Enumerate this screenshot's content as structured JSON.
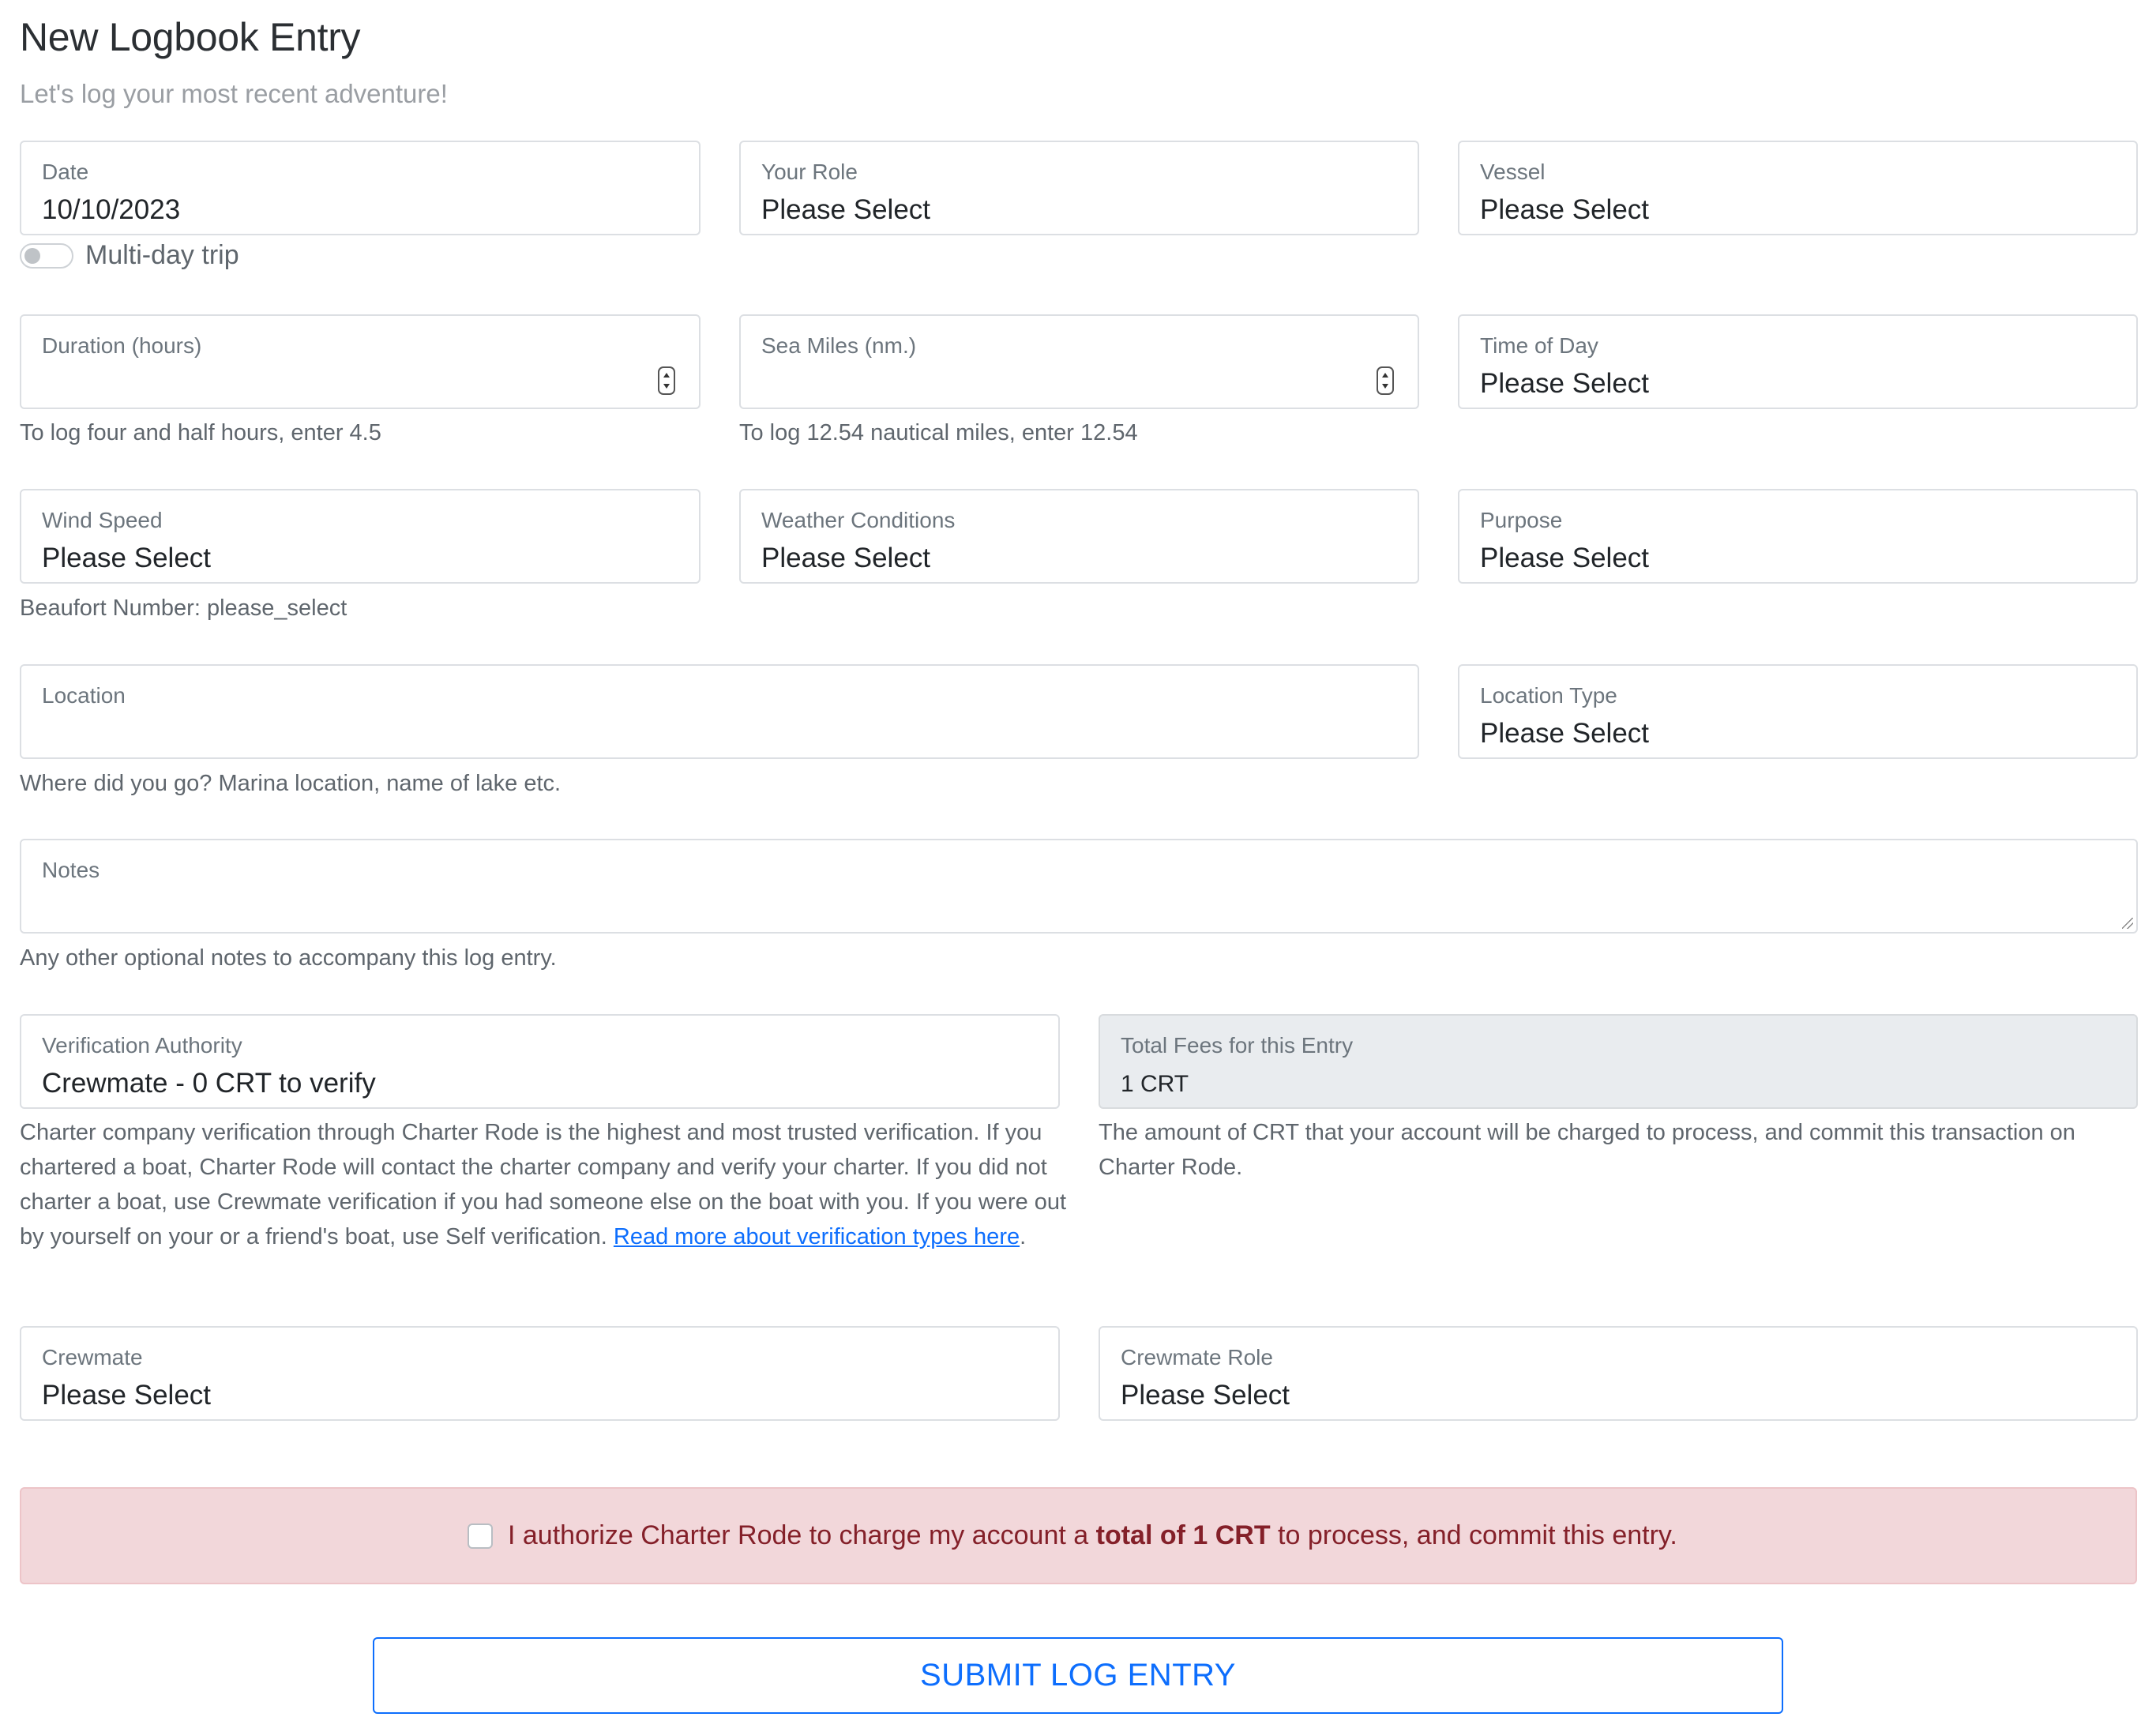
{
  "header": {
    "title": "New Logbook Entry",
    "subtitle": "Let's log your most recent adventure!"
  },
  "fields": {
    "date": {
      "label": "Date",
      "value": "10/10/2023"
    },
    "role": {
      "label": "Your Role",
      "value": "Please Select"
    },
    "vessel": {
      "label": "Vessel",
      "value": "Please Select"
    },
    "multiday": {
      "label": "Multi-day trip",
      "checked": false
    },
    "duration": {
      "label": "Duration (hours)",
      "value": "",
      "help": "To log four and half hours, enter 4.5"
    },
    "sea_miles": {
      "label": "Sea Miles (nm.)",
      "value": "",
      "help": "To log 12.54 nautical miles, enter 12.54"
    },
    "time_of_day": {
      "label": "Time of Day",
      "value": "Please Select"
    },
    "wind_speed": {
      "label": "Wind Speed",
      "value": "Please Select",
      "help": "Beaufort Number: please_select"
    },
    "weather": {
      "label": "Weather Conditions",
      "value": "Please Select"
    },
    "purpose": {
      "label": "Purpose",
      "value": "Please Select"
    },
    "location": {
      "label": "Location",
      "value": "",
      "help": "Where did you go? Marina location, name of lake etc."
    },
    "location_type": {
      "label": "Location Type",
      "value": "Please Select"
    },
    "notes": {
      "label": "Notes",
      "value": "",
      "help": "Any other optional notes to accompany this log entry."
    },
    "verification": {
      "label": "Verification Authority",
      "value": "Crewmate - 0 CRT to verify",
      "help": "Charter company verification through Charter Rode is the highest and most trusted verification. If you chartered a boat, Charter Rode will contact the charter company and verify your charter. If you did not charter a boat, use Crewmate verification if you had someone else on the boat with you. If you were out by yourself on your or a friend's boat, use Self verification.",
      "link_text": "Read more about verification types here",
      "help_end": "."
    },
    "total_fees": {
      "label": "Total Fees for this Entry",
      "value": "1 CRT",
      "help": "The amount of CRT that your account will be charged to process, and commit this transaction on Charter Rode."
    },
    "crewmate": {
      "label": "Crewmate",
      "value": "Please Select"
    },
    "crewmate_role": {
      "label": "Crewmate Role",
      "value": "Please Select"
    }
  },
  "authorize": {
    "prefix": "I authorize Charter Rode to charge my account a ",
    "bold": "total of 1 CRT",
    "suffix": " to process, and commit this entry.",
    "checked": false
  },
  "submit": {
    "label": "SUBMIT LOG ENTRY"
  },
  "colors": {
    "primary": "#0d6efd",
    "alert_bg": "#f2d7da",
    "alert_text": "#842029",
    "muted": "#6c757d"
  }
}
